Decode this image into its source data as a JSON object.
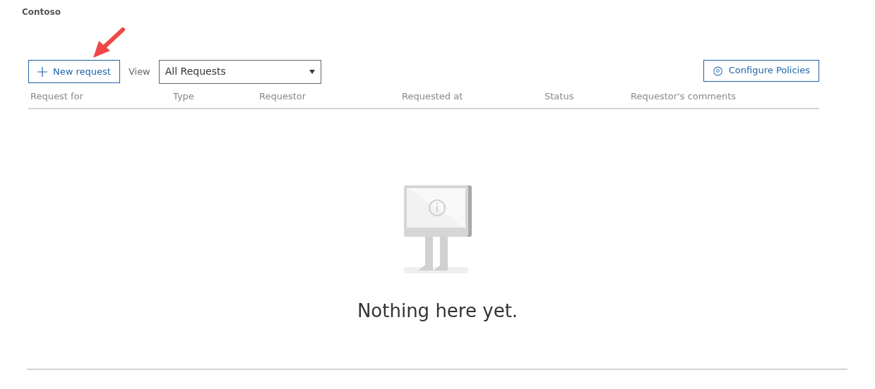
{
  "brand": "Contoso",
  "toolbar": {
    "new_button": "New request",
    "view_label": "View",
    "view_select": "All Requests",
    "configure_button": "Configure Policies"
  },
  "table": {
    "columns": [
      "Request for",
      "Type",
      "Requestor",
      "Requested at",
      "Status",
      "Requestor's comments"
    ]
  },
  "empty_state": {
    "message": "Nothing here yet."
  }
}
